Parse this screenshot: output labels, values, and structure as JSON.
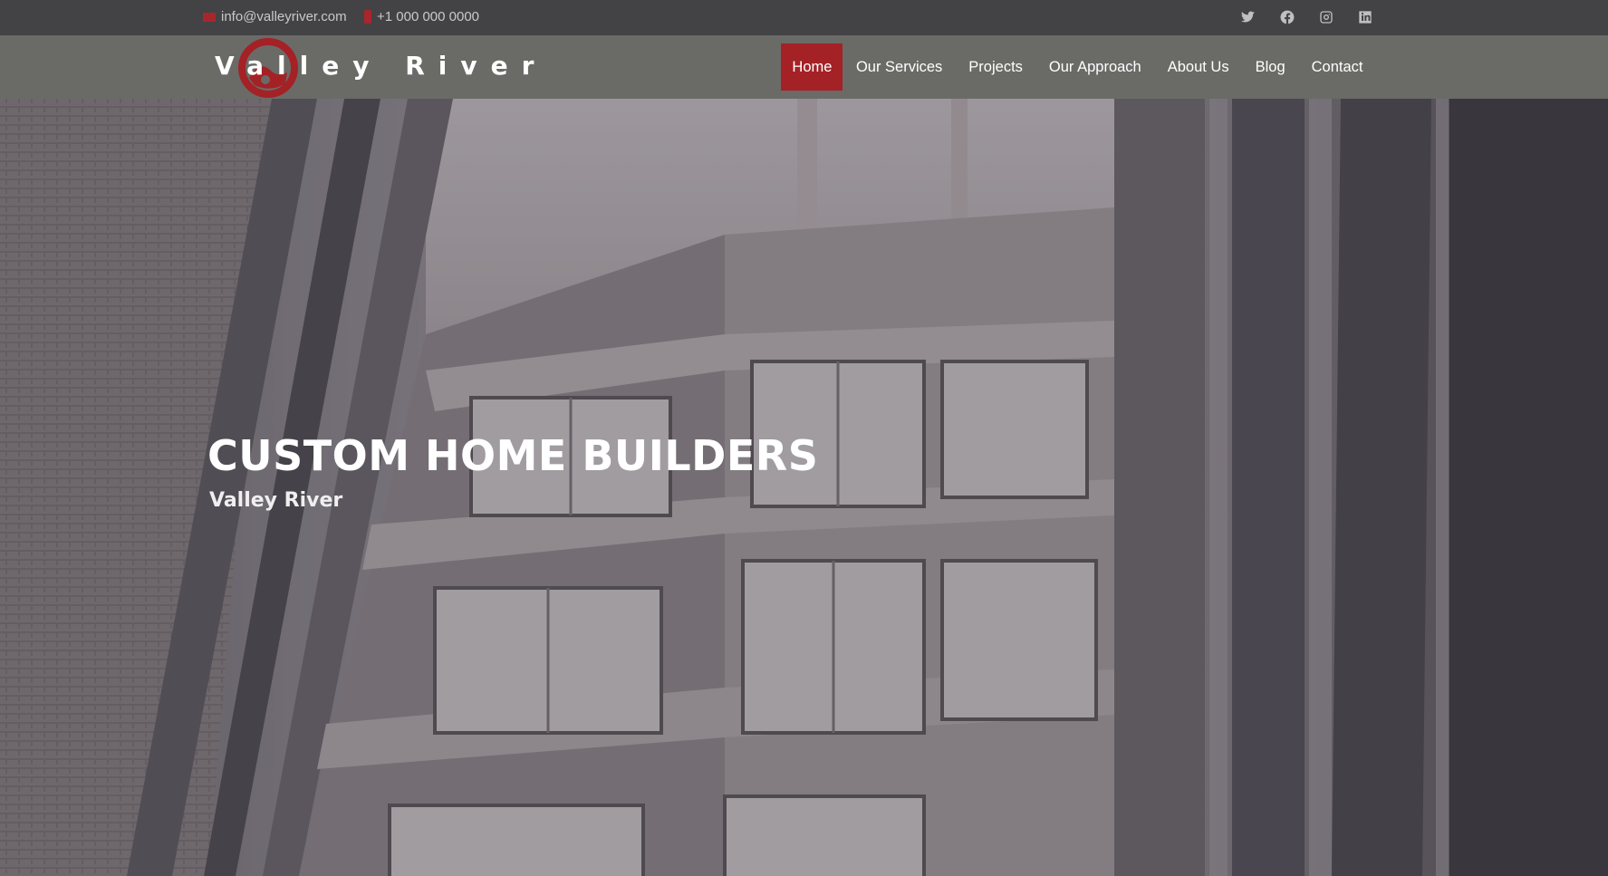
{
  "topbar": {
    "email": "info@valleyriver.com",
    "phone": "+1 000 000 0000",
    "social": [
      "twitter-icon",
      "facebook-icon",
      "instagram-icon",
      "linkedin-icon"
    ]
  },
  "header": {
    "logo_text": "Valley River",
    "nav": [
      {
        "label": "Home",
        "active": true
      },
      {
        "label": "Our Services"
      },
      {
        "label": "Projects"
      },
      {
        "label": "Our Approach"
      },
      {
        "label": "About Us"
      },
      {
        "label": "Blog"
      },
      {
        "label": "Contact"
      }
    ]
  },
  "hero": {
    "title": "CUSTOM HOME BUILDERS",
    "subtitle": "Valley River"
  },
  "colors": {
    "accent": "#a42126",
    "topbar_bg": "#434245",
    "header_bg": "#6a6b67"
  }
}
